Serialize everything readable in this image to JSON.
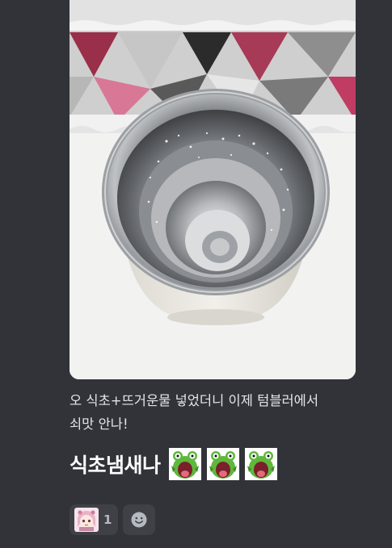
{
  "message": {
    "attachment": {
      "kind": "photo",
      "subject": "stainless-tumbler"
    },
    "text_line1": "오 식초+뜨거운물 넣었더니 이제 텀블러에서",
    "text_line2": "쇠맛 안나!",
    "big_text": "식초냄새나",
    "emotes": [
      {
        "icon": "green-frog-screaming-emote"
      },
      {
        "icon": "green-frog-screaming-emote"
      },
      {
        "icon": "green-frog-screaming-emote"
      }
    ]
  },
  "reactions": [
    {
      "icon": "anime-girl-sticker-emote",
      "count": "1"
    },
    {
      "icon": "add-reaction-icon"
    }
  ],
  "colors": {
    "background": "#313338",
    "reaction_bg": "#3f4147",
    "text": "#e3e5e8",
    "frog_green": "#5fb83c"
  }
}
